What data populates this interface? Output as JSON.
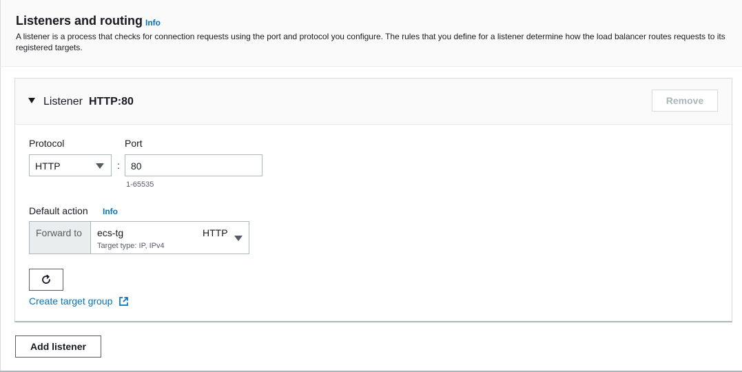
{
  "section": {
    "title": "Listeners and routing",
    "info": "Info",
    "description": "A listener is a process that checks for connection requests using the port and protocol you configure. The rules that you define for a listener determine how the load balancer routes requests to its registered targets."
  },
  "listener": {
    "label": "Listener",
    "value": "HTTP:80",
    "remove_label": "Remove",
    "protocol": {
      "label": "Protocol",
      "value": "HTTP"
    },
    "port": {
      "label": "Port",
      "value": "80",
      "hint": "1-65535",
      "separator": ":"
    },
    "default_action": {
      "label": "Default action",
      "info": "Info",
      "prefix": "Forward to",
      "target_group_name": "ecs-tg",
      "target_group_sub": "Target type: IP, IPv4",
      "target_group_protocol": "HTTP"
    },
    "create_target_group_label": "Create target group"
  },
  "add_listener_label": "Add listener",
  "icons": {
    "expand": "caret-down-icon",
    "dropdown": "triangle-down-icon",
    "refresh": "refresh-icon",
    "external": "external-link-icon"
  },
  "colors": {
    "link": "#0073bb",
    "text": "#16191f",
    "muted": "#545b64",
    "border": "#aab7b8"
  }
}
